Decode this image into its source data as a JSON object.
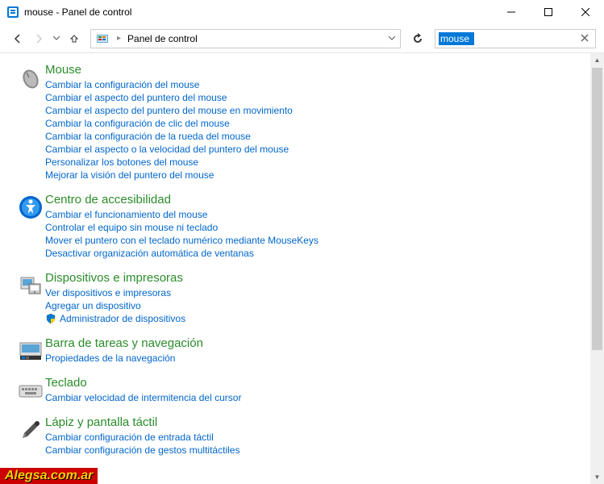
{
  "window": {
    "title": "mouse - Panel de control"
  },
  "address": {
    "crumb": "Panel de control"
  },
  "search": {
    "value": "mouse"
  },
  "sections": [
    {
      "title": "Mouse",
      "icon": "mouse",
      "links": [
        {
          "text": "Cambiar la configuración del mouse"
        },
        {
          "text": "Cambiar el aspecto del puntero del mouse"
        },
        {
          "text": "Cambiar el aspecto del puntero del mouse en movimiento"
        },
        {
          "text": "Cambiar la configuración de clic del mouse"
        },
        {
          "text": "Cambiar la configuración de la rueda del mouse"
        },
        {
          "text": "Cambiar el aspecto o la velocidad del puntero del mouse"
        },
        {
          "text": "Personalizar los botones del mouse"
        },
        {
          "text": "Mejorar la visión del puntero del mouse"
        }
      ]
    },
    {
      "title": "Centro de accesibilidad",
      "icon": "accessibility",
      "links": [
        {
          "text": "Cambiar el funcionamiento del mouse"
        },
        {
          "text": "Controlar el equipo sin mouse ni teclado"
        },
        {
          "text": "Mover el puntero con el teclado numérico mediante MouseKeys"
        },
        {
          "text": "Desactivar organización automática de ventanas"
        }
      ]
    },
    {
      "title": "Dispositivos e impresoras",
      "icon": "devices",
      "links": [
        {
          "text": "Ver dispositivos e impresoras"
        },
        {
          "text": "Agregar un dispositivo"
        },
        {
          "text": "Administrador de dispositivos",
          "shield": true
        }
      ]
    },
    {
      "title": "Barra de tareas y navegación",
      "icon": "taskbar",
      "links": [
        {
          "text": "Propiedades de la navegación"
        }
      ]
    },
    {
      "title": "Teclado",
      "icon": "keyboard",
      "links": [
        {
          "text": "Cambiar velocidad de intermitencia del cursor"
        }
      ]
    },
    {
      "title": "Lápiz y pantalla táctil",
      "icon": "pen",
      "links": [
        {
          "text": "Cambiar configuración de entrada táctil"
        },
        {
          "text": "Cambiar configuración de gestos multitáctiles"
        }
      ]
    }
  ],
  "watermark": "Alegsa.com.ar"
}
